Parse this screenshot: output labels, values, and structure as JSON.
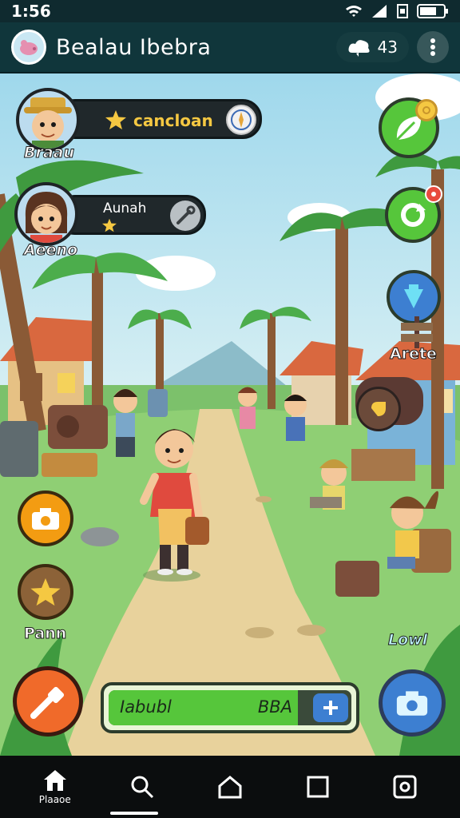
{
  "status": {
    "time": "1:56"
  },
  "app": {
    "title": "Bealau Ibebra",
    "currency_value": "43"
  },
  "quests": [
    {
      "label": "cancloan",
      "player": "Braau"
    },
    {
      "label": "Aunah",
      "player": "Aeeno"
    }
  ],
  "side_labels": {
    "right": "Arete",
    "left": "Pann",
    "bottom_right": "Lowl"
  },
  "progress": {
    "label": "Iabubl",
    "value_text": "BBA",
    "fill": 0.78
  },
  "nav": {
    "home_label": "Plaaoe"
  },
  "colors": {
    "accent_green": "#56c63b",
    "accent_orange": "#f39c12",
    "appbar": "#10363b",
    "sky": "#bfe7f2",
    "grass": "#7cc16b"
  }
}
